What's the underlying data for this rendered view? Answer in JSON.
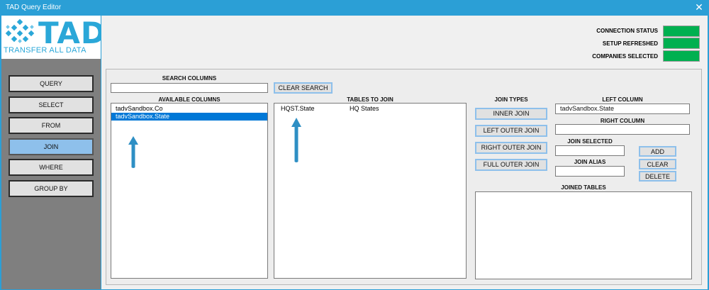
{
  "window": {
    "title": "TAD Query Editor",
    "close_glyph": "✕"
  },
  "logo": {
    "main": "TAD",
    "sub": "TRANSFER ALL DATA"
  },
  "nav": [
    {
      "label": "QUERY",
      "active": false
    },
    {
      "label": "SELECT",
      "active": false
    },
    {
      "label": "FROM",
      "active": false
    },
    {
      "label": "JOIN",
      "active": true
    },
    {
      "label": "WHERE",
      "active": false
    },
    {
      "label": "GROUP BY",
      "active": false
    }
  ],
  "status": [
    {
      "label": "CONNECTION STATUS",
      "color": "#00b050"
    },
    {
      "label": "SETUP REFRESHED",
      "color": "#00b050"
    },
    {
      "label": "COMPANIES SELECTED",
      "color": "#00b050"
    }
  ],
  "search": {
    "label": "SEARCH COLUMNS",
    "value": "",
    "clear_label": "CLEAR SEARCH"
  },
  "available": {
    "label": "AVAILABLE COLUMNS",
    "items": [
      {
        "text": "tadvSandbox.Co",
        "selected": false
      },
      {
        "text": "tadvSandbox.State",
        "selected": true
      }
    ]
  },
  "tables": {
    "label": "TABLES TO JOIN",
    "items": [
      {
        "name": "HQST.State",
        "desc": "HQ States"
      }
    ]
  },
  "join_types": {
    "label": "JOIN TYPES",
    "buttons": [
      "INNER JOIN",
      "LEFT OUTER JOIN",
      "RIGHT OUTER JOIN",
      "FULL OUTER JOIN"
    ]
  },
  "left_column": {
    "label": "LEFT COLUMN",
    "value": "tadvSandbox.State"
  },
  "right_column": {
    "label": "RIGHT COLUMN",
    "value": ""
  },
  "join_selected": {
    "label": "JOIN SELECTED",
    "value": ""
  },
  "join_alias": {
    "label": "JOIN ALIAS",
    "value": ""
  },
  "actions": {
    "add": "ADD",
    "clear": "CLEAR",
    "delete": "DELETE"
  },
  "joined_tables": {
    "label": "JOINED TABLES"
  },
  "colors": {
    "accent": "#2b9fd6",
    "status_ok": "#00b050",
    "selection": "#0078d7",
    "arrow": "#2e8fc4"
  }
}
